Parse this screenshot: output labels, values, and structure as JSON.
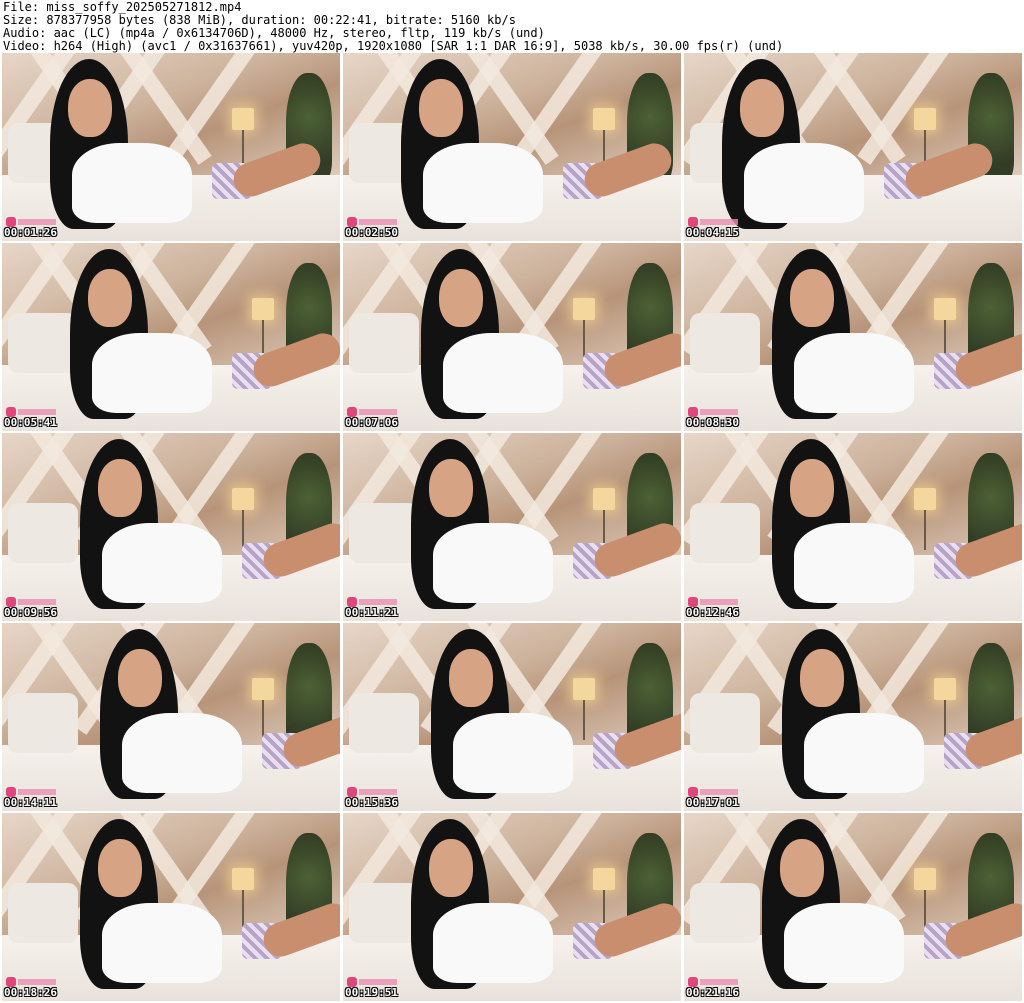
{
  "info": {
    "file": "File: miss_soffy_202505271812.mp4",
    "size": "Size: 878377958 bytes (838 MiB), duration: 00:22:41, bitrate: 5160 kb/s",
    "audio": "Audio: aac (LC) (mp4a / 0x6134706D), 48000 Hz, stereo, fltp, 119 kb/s (und)",
    "video": "Video: h264 (High) (avc1 / 0x31637661), yuv420p, 1920x1080 [SAR 1:1 DAR 16:9], 5038 kb/s, 30.00 fps(r) (und)"
  },
  "thumbnails": [
    {
      "timestamp": "00:01:26"
    },
    {
      "timestamp": "00:02:50"
    },
    {
      "timestamp": "00:04:15"
    },
    {
      "timestamp": "00:05:41"
    },
    {
      "timestamp": "00:07:06"
    },
    {
      "timestamp": "00:08:30"
    },
    {
      "timestamp": "00:09:56"
    },
    {
      "timestamp": "00:11:21"
    },
    {
      "timestamp": "00:12:46"
    },
    {
      "timestamp": "00:14:11"
    },
    {
      "timestamp": "00:15:36"
    },
    {
      "timestamp": "00:17:01"
    },
    {
      "timestamp": "00:18:26"
    },
    {
      "timestamp": "00:19:51"
    },
    {
      "timestamp": "00:21:16"
    }
  ],
  "colors": {
    "background": "#ffffff",
    "text": "#000000",
    "timestamp": "#ffffff"
  }
}
